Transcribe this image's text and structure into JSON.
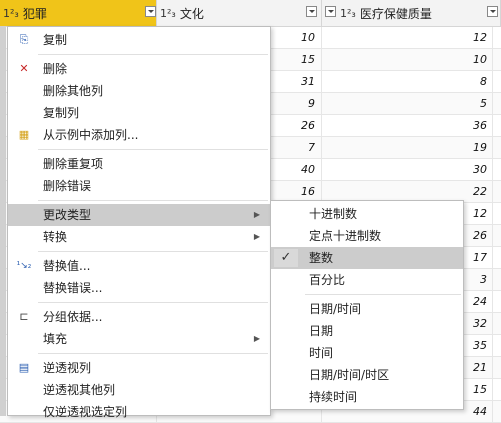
{
  "columns": [
    {
      "type_icon": "1²₃",
      "name": "犯罪"
    },
    {
      "type_icon": "1²₃",
      "name": "文化"
    },
    {
      "type_icon": "1²₃",
      "name": "医疗保健质量"
    }
  ],
  "rows": [
    {
      "c2": "10",
      "c3": "12"
    },
    {
      "c2": "15",
      "c3": "10"
    },
    {
      "c2": "31",
      "c3": "8"
    },
    {
      "c2": "9",
      "c3": "5"
    },
    {
      "c2": "26",
      "c3": "36"
    },
    {
      "c2": "7",
      "c3": "19"
    },
    {
      "c2": "40",
      "c3": "30"
    },
    {
      "c2": "16",
      "c3": "22"
    },
    {
      "c2": "",
      "c3": "12"
    },
    {
      "c2": "",
      "c3": "26"
    },
    {
      "c2": "",
      "c3": "17"
    },
    {
      "c2": "",
      "c3": "3"
    },
    {
      "c2": "",
      "c3": "24"
    },
    {
      "c2": "",
      "c3": "32"
    },
    {
      "c2": "",
      "c3": "35"
    },
    {
      "c2": "",
      "c3": "21"
    },
    {
      "c2": "",
      "c3": "15"
    },
    {
      "c2": "",
      "c3": "44"
    }
  ],
  "context_menu": {
    "copy": "复制",
    "delete": "删除",
    "delete_other_columns": "删除其他列",
    "duplicate_column": "复制列",
    "add_column_from_examples": "从示例中添加列...",
    "remove_duplicates": "删除重复项",
    "remove_errors": "删除错误",
    "change_type": "更改类型",
    "transform": "转换",
    "replace_values": "替换值...",
    "replace_errors": "替换错误...",
    "group_by": "分组依据...",
    "fill": "填充",
    "unpivot_columns": "逆透视列",
    "unpivot_other_columns": "逆透视其他列",
    "unpivot_selected_columns": "仅逆透视选定列"
  },
  "type_submenu": {
    "decimal": "十进制数",
    "fixed_decimal": "定点十进制数",
    "whole_number": "整数",
    "percentage": "百分比",
    "date_time": "日期/时间",
    "date": "日期",
    "time": "时间",
    "date_time_timezone": "日期/时间/时区",
    "duration": "持续时间",
    "checkmark": "✓"
  }
}
